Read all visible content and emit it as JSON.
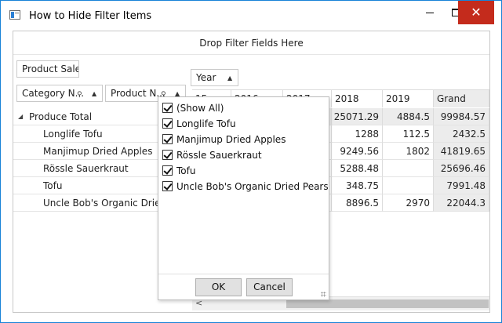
{
  "window": {
    "title": "How to Hide Filter Items"
  },
  "pivot": {
    "filter_drop_text": "Drop Filter Fields Here",
    "data_field": "Product Sales",
    "column_field": "Year",
    "row_fields": [
      "Category N...",
      "Product N..."
    ],
    "column_headers": [
      "15",
      "2016",
      "2017",
      "2018",
      "2019",
      "Grand Total"
    ],
    "rows": [
      {
        "label": "Produce Total",
        "expander": "◢",
        "v2018": "25071.29",
        "v2019": "4884.5",
        "grand": "99984.57"
      },
      {
        "label": "Longlife Tofu",
        "v2018": "1288",
        "v2019": "112.5",
        "grand": "2432.5"
      },
      {
        "label": "Manjimup Dried Apples",
        "v2018": "9249.56",
        "v2019": "1802",
        "grand": "41819.65"
      },
      {
        "label": "Rössle Sauerkraut",
        "v2018": "5288.48",
        "v2019": "",
        "grand": "25696.46"
      },
      {
        "label": "Tofu",
        "v2018": "348.75",
        "v2019": "",
        "grand": "7991.48"
      },
      {
        "label": "Uncle Bob's Organic Dried P",
        "v2018": "8896.5",
        "v2019": "2970",
        "grand": "22044.3"
      }
    ]
  },
  "filter_popup": {
    "items": [
      {
        "label": "(Show All)",
        "checked": true
      },
      {
        "label": "Longlife Tofu",
        "checked": true
      },
      {
        "label": "Manjimup Dried Apples",
        "checked": true
      },
      {
        "label": "Rössle Sauerkraut",
        "checked": true
      },
      {
        "label": "Tofu",
        "checked": true
      },
      {
        "label": "Uncle Bob's Organic Dried Pears",
        "checked": true
      }
    ],
    "ok_label": "OK",
    "cancel_label": "Cancel"
  },
  "colors": {
    "close_button": "#c42b1c",
    "window_border": "#1883d7",
    "grand_total_bg": "#ececec"
  }
}
